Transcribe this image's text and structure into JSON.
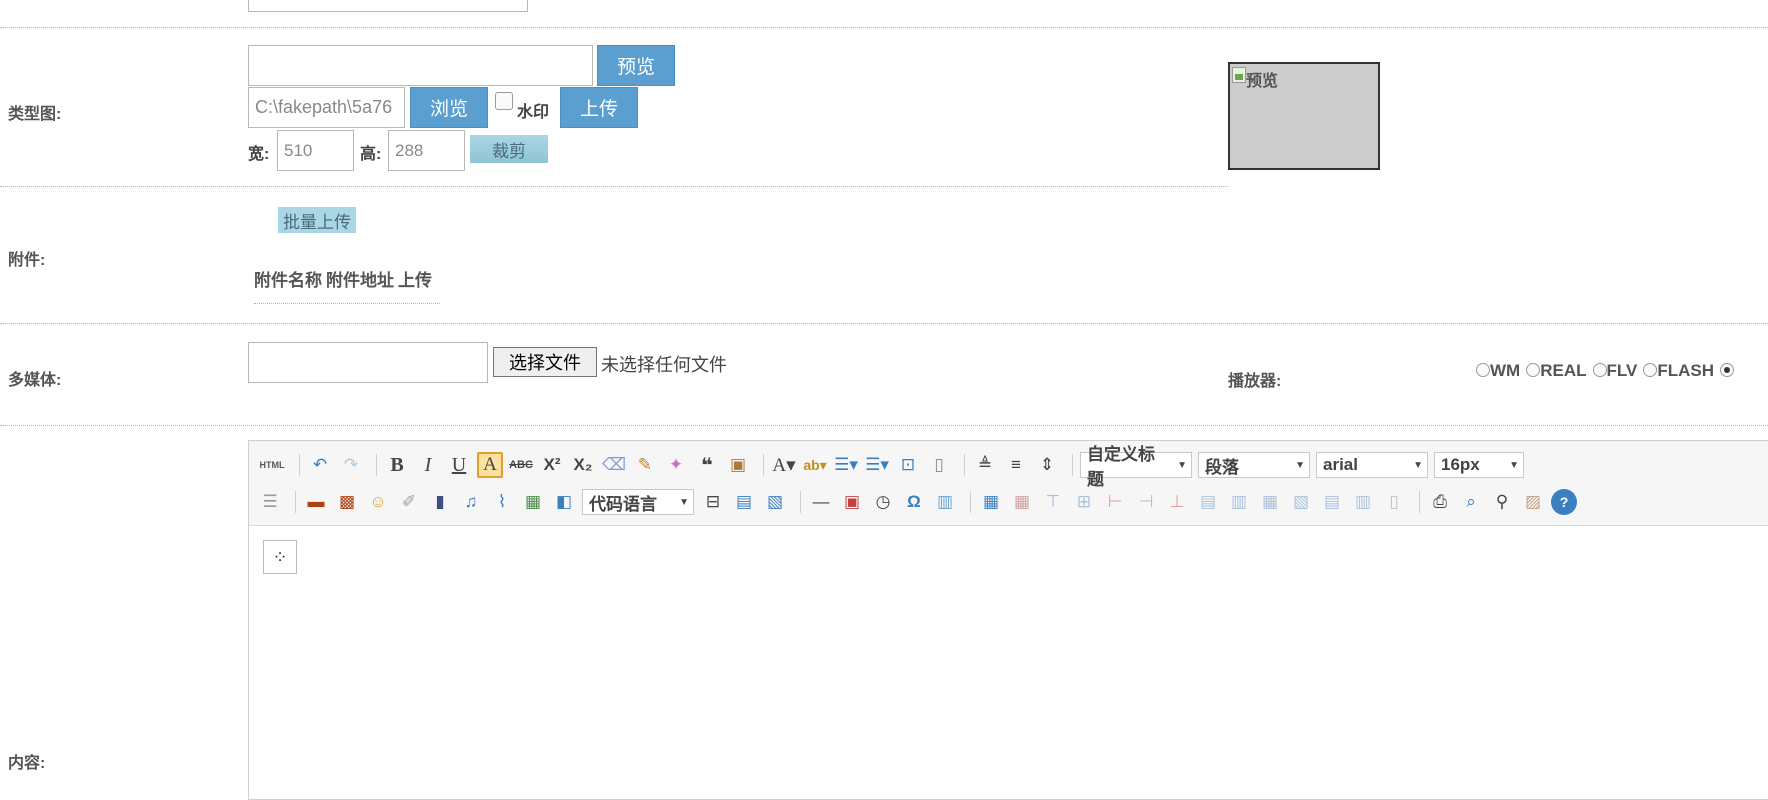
{
  "form": {
    "type_image": {
      "label": "类型图:",
      "preview_button": "预览",
      "file_path_value": "C:\\fakepath\\5a76",
      "browse_button": "浏览",
      "watermark_label": "水印",
      "upload_button": "上传",
      "width_label": "宽:",
      "width_value": "510",
      "height_label": "高:",
      "height_value": "288",
      "crop_button": "裁剪",
      "preview_image_alt": "预览"
    },
    "attachment": {
      "label": "附件:",
      "batch_upload_button": "批量上传",
      "columns": [
        "附件名称",
        "附件地址",
        "上传"
      ]
    },
    "multimedia": {
      "label": "多媒体:",
      "choose_file_button": "选择文件",
      "no_file_text": "未选择任何文件",
      "player_label": "播放器:",
      "players": [
        {
          "label": "WM",
          "selected": false
        },
        {
          "label": "REAL",
          "selected": false
        },
        {
          "label": "FLV",
          "selected": false
        },
        {
          "label": "FLASH",
          "selected": false
        },
        {
          "label": "",
          "selected": true
        }
      ]
    },
    "content": {
      "label": "内容:"
    }
  },
  "editor": {
    "toolbar_row1": {
      "html_button": "HTML",
      "custom_heading": "自定义标题",
      "paragraph": "段落",
      "font_family": "arial",
      "font_size": "16px"
    },
    "toolbar_row2": {
      "code_language": "代码语言"
    },
    "icons_row1": [
      "undo-icon",
      "redo-icon",
      "bold-icon",
      "italic-icon",
      "underline-icon",
      "font-border-icon",
      "strikethrough-icon",
      "superscript-icon",
      "subscript-icon",
      "eraser-icon",
      "format-brush-icon",
      "auto-format-icon",
      "blockquote-icon",
      "paste-text-icon",
      "font-color-icon",
      "background-color-icon",
      "ordered-list-icon",
      "unordered-list-icon",
      "select-all-icon",
      "clear-doc-icon",
      "row-spacing-top-icon",
      "row-spacing-bottom-icon",
      "line-height-icon"
    ],
    "icons_row2": [
      "align-center-icon",
      "image-icon",
      "multi-image-icon",
      "emotion-icon",
      "scrawl-icon",
      "video-icon",
      "music-icon",
      "attachment-icon",
      "map-icon",
      "web-map-icon",
      "insert-frame-icon",
      "page-break-icon",
      "template-icon",
      "horizontal-rule-icon",
      "date-icon",
      "time-icon",
      "special-char-icon",
      "word-image-icon",
      "table-icon",
      "delete-table-icon",
      "insert-para-before-icon",
      "insert-row-icon",
      "delete-row-icon",
      "insert-col-icon",
      "delete-col-icon",
      "merge-cells-icon",
      "merge-right-icon",
      "merge-down-icon",
      "split-cells-icon",
      "split-rows-icon",
      "split-cols-icon",
      "chart-icon",
      "print-icon",
      "preview-icon",
      "search-replace-icon",
      "draft-icon",
      "help-icon"
    ]
  },
  "colors": {
    "accent_blue": "#5a9fd0",
    "light_button": "#a9d7e6",
    "label_gray": "#555555"
  }
}
